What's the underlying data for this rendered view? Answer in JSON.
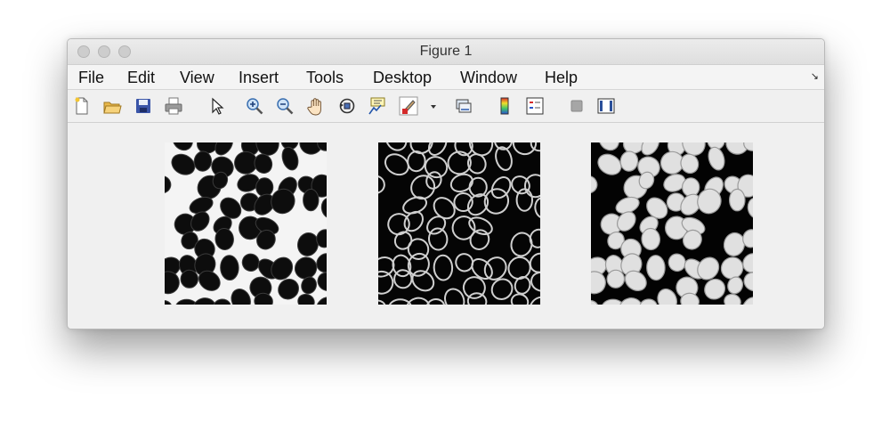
{
  "window": {
    "title": "Figure 1"
  },
  "menu": {
    "items": [
      "File",
      "Edit",
      "View",
      "Insert",
      "Tools",
      "Desktop",
      "Window",
      "Help"
    ],
    "corner_icon": "dock-arrow-icon"
  },
  "toolbar": {
    "icons": [
      "new-figure-icon",
      "open-file-icon",
      "save-icon",
      "print-icon",
      "pointer-icon",
      "zoom-in-icon",
      "zoom-out-icon",
      "pan-hand-icon",
      "rotate-3d-icon",
      "data-cursor-icon",
      "brush-icon",
      "dropdown-arrow-icon",
      "link-plot-icon",
      "colorbar-icon",
      "legend-icon",
      "hide-plot-tools-icon",
      "show-plot-tools-icon"
    ]
  },
  "axes": [
    {
      "name": "cells-inverted-image",
      "colormap": "gray",
      "style": "dark cells on light background"
    },
    {
      "name": "cells-edge-image",
      "colormap": "gray",
      "style": "bright cell outlines on dark background"
    },
    {
      "name": "cells-filled-image",
      "colormap": "gray",
      "style": "bright cells on dark background"
    }
  ],
  "colors": {
    "window_bg": "#f0f0f0",
    "titlebar": "#e4e4e4",
    "brush_red": "#d42a2a"
  }
}
